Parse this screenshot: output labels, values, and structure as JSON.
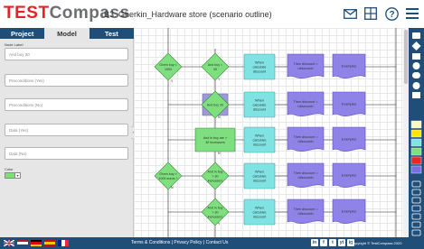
{
  "logo": {
    "part1": "TEST",
    "part2": "Compass"
  },
  "header": {
    "title": "B3. Gherkin_Hardware store (scenario outline)",
    "icons": [
      "mail-icon",
      "grid-icon",
      "help-icon",
      "menu-icon"
    ]
  },
  "tabs": [
    {
      "label": "Project",
      "active": false
    },
    {
      "label": "Model",
      "active": true
    },
    {
      "label": "Test",
      "active": false
    }
  ],
  "left_panel": {
    "node_label_caption": "Node Label",
    "fields": [
      "And buy 30",
      "Preconditions (Yes)",
      "Preconditions (No)",
      "Data (Yes)",
      "Data (No)"
    ],
    "color_caption": "Color",
    "color_value": "#7ddf7d"
  },
  "diagram": {
    "rows": [
      {
        "decision1": "Given buy < 1000",
        "decision2": "And buy < 30",
        "action": "When calculate discount",
        "result": "Then discount = <discount>",
        "examples": "Examples"
      },
      {
        "decision1": "",
        "decision2": "And buy 30",
        "action": "When calculate discount",
        "result": "Then discount = <discount>",
        "examples": "Examples"
      },
      {
        "decision1": "",
        "decision2": "And in buy are > 30 increasers",
        "action": "When calculate discount",
        "result": "Then discount = <discount>",
        "examples": "Examples"
      },
      {
        "decision1": "Given buy > 1000 euros ?",
        "decision2": "And in buy > 30 increasers",
        "action": "When calculate discount",
        "result": "Then discount = <discount>",
        "examples": "Examples"
      },
      {
        "decision1": "",
        "decision2": "And in buy > 30 increasers",
        "action": "When calculate discount",
        "result": "Then discount = <discount>",
        "examples": "Examples"
      }
    ],
    "edge_labels": [
      "Y",
      "N",
      "Y",
      "N",
      "N",
      "Y"
    ]
  },
  "toolbar": {
    "tools": [
      "eraser-icon",
      "diamond-icon",
      "rectangle-icon",
      "circle-icon",
      "terminator-icon",
      "info-icon",
      "document-icon"
    ],
    "colors": [
      "#fff8c4",
      "#ffe600",
      "#7fe3e3",
      "#7ddf7d",
      "#e8262c",
      "#7a6fe0"
    ],
    "actions": [
      "undo-icon",
      "redo-icon",
      "copy-icon",
      "paste-icon",
      "zoom-in-icon",
      "zoom-out-icon",
      "fit-icon"
    ]
  },
  "footer": {
    "links": "Terms & Conditions | Privacy Policy | Contact Us",
    "social": [
      "in",
      "f",
      "t",
      "yt",
      "ig"
    ],
    "copyright": "Copyright © TestCompass 2020"
  }
}
